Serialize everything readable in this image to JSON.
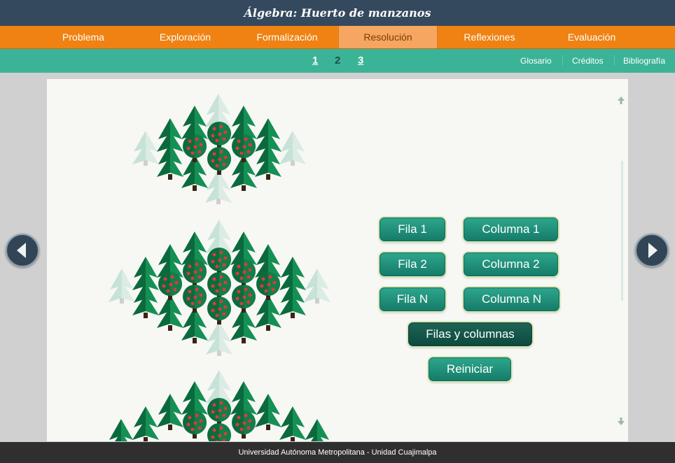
{
  "app": {
    "title": "Álgebra: Huerto de manzanos"
  },
  "nav": {
    "tabs": [
      {
        "label": "Problema"
      },
      {
        "label": "Exploración"
      },
      {
        "label": "Formalización"
      },
      {
        "label": "Resolución",
        "active": true
      },
      {
        "label": "Reflexiones"
      },
      {
        "label": "Evaluación"
      }
    ]
  },
  "pages": {
    "items": [
      "1",
      "2",
      "3"
    ],
    "current": "2"
  },
  "links": {
    "glosario": "Glosario",
    "creditos": "Créditos",
    "bibliografia": "Bibliografía"
  },
  "buttons": {
    "fila1": "Fila 1",
    "columna1": "Columna 1",
    "fila2": "Fila 2",
    "columna2": "Columna 2",
    "filaN": "Fila N",
    "columnaN": "Columna N",
    "filas_columnas": "Filas y columnas",
    "reiniciar": "Reiniciar"
  },
  "icons": {
    "prev": "left-triangle-icon",
    "next": "right-triangle-icon",
    "scroll_up": "arrow-up-icon",
    "scroll_down": "arrow-down-icon",
    "apple_tree": "apple-tree-icon",
    "conifer": "conifer-tree-icon"
  },
  "footer": {
    "text": "Universidad Autónoma Metropolitana - Unidad Cuajimalpa"
  },
  "colors": {
    "header": "#34495e",
    "nav": "#ef8212",
    "nav_active": "#f6a660",
    "subnav": "#3bb396",
    "button": "#1c8c76",
    "tree_dark": "#0d6b3f",
    "tree_light": "#b9d9cb",
    "apple": "#d83a3a",
    "footer": "#2f2f2f"
  }
}
